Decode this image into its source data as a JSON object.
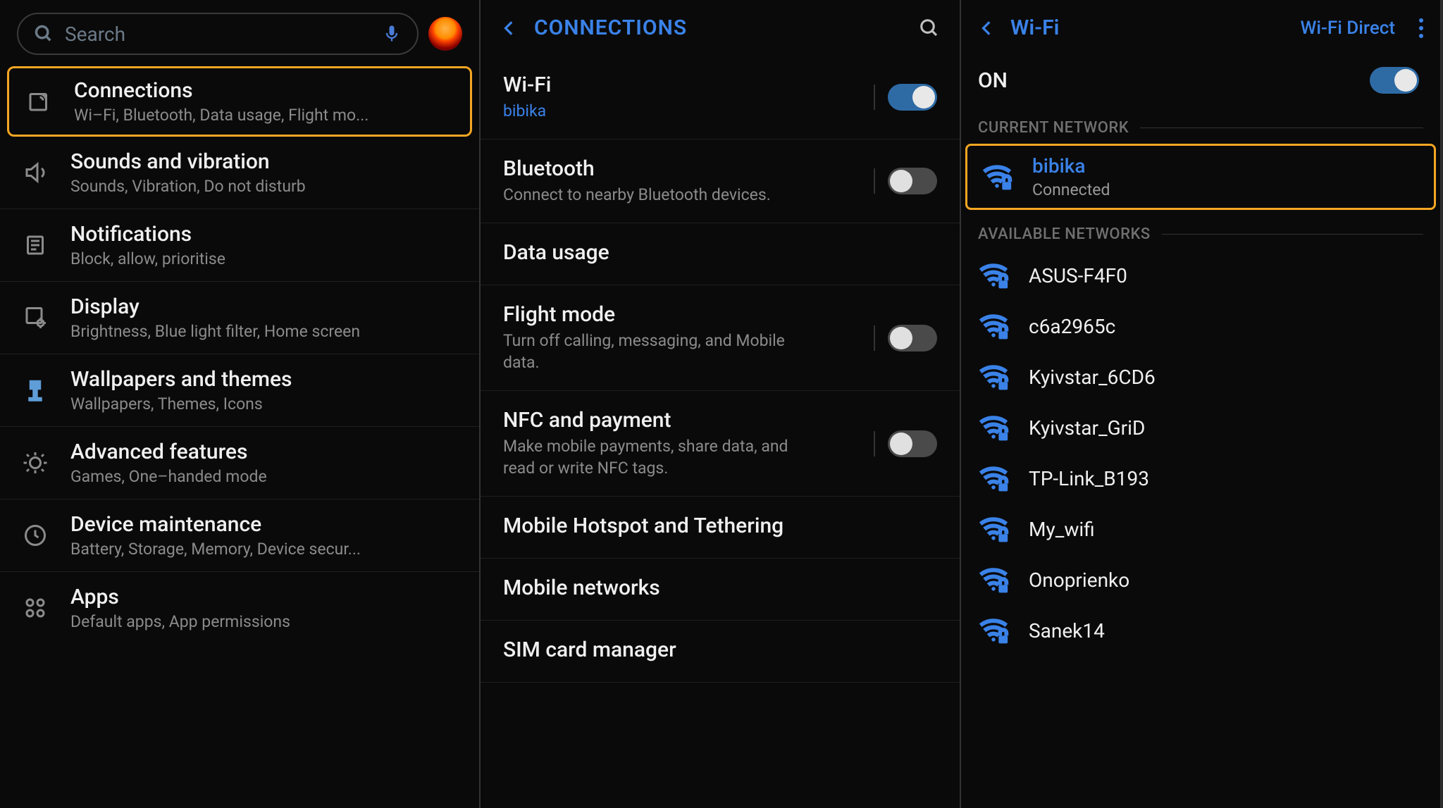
{
  "panel1": {
    "search_placeholder": "Search",
    "items": [
      {
        "title": "Connections",
        "sub": "Wi–Fi, Bluetooth, Data usage, Flight mo..."
      },
      {
        "title": "Sounds and vibration",
        "sub": "Sounds, Vibration, Do not disturb"
      },
      {
        "title": "Notifications",
        "sub": "Block, allow, prioritise"
      },
      {
        "title": "Display",
        "sub": "Brightness, Blue light filter, Home screen"
      },
      {
        "title": "Wallpapers and themes",
        "sub": "Wallpapers, Themes, Icons"
      },
      {
        "title": "Advanced features",
        "sub": "Games, One–handed mode"
      },
      {
        "title": "Device maintenance",
        "sub": "Battery, Storage, Memory, Device secur..."
      },
      {
        "title": "Apps",
        "sub": "Default apps, App permissions"
      }
    ]
  },
  "panel2": {
    "header": "CONNECTIONS",
    "items": [
      {
        "title": "Wi-Fi",
        "sub": "bibika",
        "sub_blue": true,
        "toggle": "on"
      },
      {
        "title": "Bluetooth",
        "sub": "Connect to nearby Bluetooth devices.",
        "toggle": "off"
      },
      {
        "title": "Data usage",
        "sub": ""
      },
      {
        "title": "Flight mode",
        "sub": "Turn off calling, messaging, and Mobile data.",
        "toggle": "off"
      },
      {
        "title": "NFC and payment",
        "sub": "Make mobile payments, share data, and read or write NFC tags.",
        "toggle": "off"
      },
      {
        "title": "Mobile Hotspot and Tethering",
        "sub": ""
      },
      {
        "title": "Mobile networks",
        "sub": ""
      },
      {
        "title": "SIM card manager",
        "sub": ""
      }
    ]
  },
  "panel3": {
    "header": "Wi-Fi",
    "wifi_direct": "Wi-Fi Direct",
    "on_label": "ON",
    "current_label": "CURRENT NETWORK",
    "available_label": "AVAILABLE NETWORKS",
    "current": {
      "name": "bibika",
      "status": "Connected"
    },
    "available": [
      "ASUS-F4F0",
      "c6a2965c",
      "Kyivstar_6CD6",
      "Kyivstar_GriD",
      "TP-Link_B193",
      "My_wifi",
      "Onoprienko",
      "Sanek14"
    ]
  }
}
